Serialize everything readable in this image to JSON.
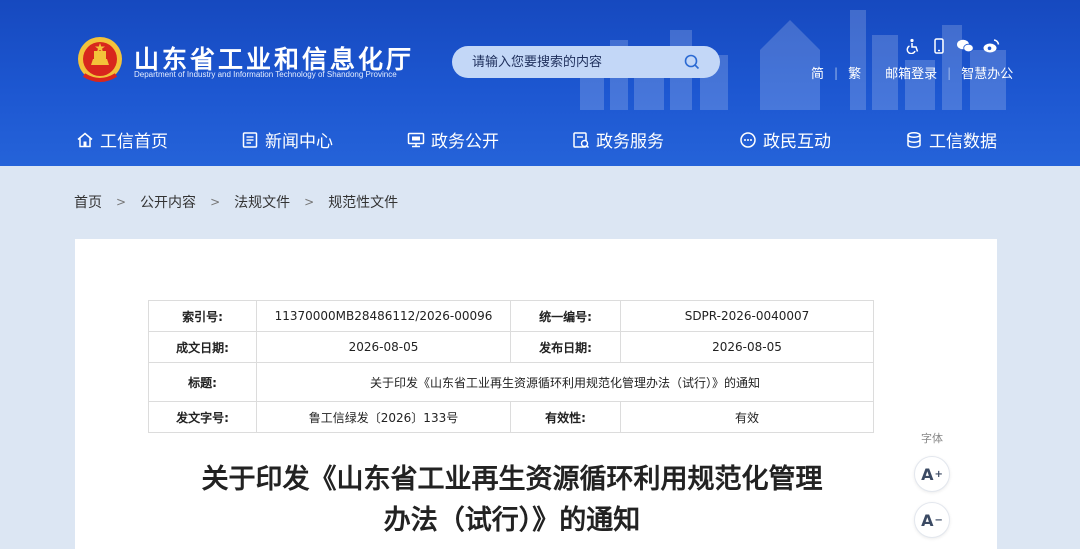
{
  "site": {
    "title": "山东省工业和信息化厅",
    "subtitle": "Department of Industry and Information Technology of Shandong Province"
  },
  "search": {
    "placeholder": "请输入您要搜索的内容"
  },
  "utility": {
    "icons": [
      "accessibility-icon",
      "mobile-icon",
      "wechat-icon",
      "weibo-icon"
    ],
    "links": [
      "简",
      "繁",
      "邮箱登录",
      "智慧办公"
    ]
  },
  "nav": [
    {
      "label": "工信首页",
      "icon": "home-icon"
    },
    {
      "label": "新闻中心",
      "icon": "news-icon"
    },
    {
      "label": "政务公开",
      "icon": "monitor-icon"
    },
    {
      "label": "政务服务",
      "icon": "service-icon"
    },
    {
      "label": "政民互动",
      "icon": "chat-icon"
    },
    {
      "label": "工信数据",
      "icon": "database-icon"
    }
  ],
  "breadcrumb": [
    "首页",
    "公开内容",
    "法规文件",
    "规范性文件"
  ],
  "meta": {
    "index_label": "索引号:",
    "index_value": "11370000MB28486112/2026-00096",
    "code_label": "统一编号:",
    "code_value": "SDPR-2026-0040007",
    "created_label": "成文日期:",
    "created_value": "2026-08-05",
    "published_label": "发布日期:",
    "published_value": "2026-08-05",
    "title_label": "标题:",
    "title_value": "关于印发《山东省工业再生资源循环利用规范化管理办法（试行）》的通知",
    "docno_label": "发文字号:",
    "docno_value": "鲁工信绿发〔2026〕133号",
    "validity_label": "有效性:",
    "validity_value": "有效"
  },
  "article": {
    "title_line1": "关于印发《山东省工业再生资源循环利用规范化管理",
    "title_line2": "办法（试行）》的通知"
  },
  "font_tool": {
    "label": "字体",
    "increase": "A",
    "decrease": "A"
  },
  "colors": {
    "header": "#1d57d1",
    "search_bg": "#c3d7f7",
    "page_bg": "#dce6f3"
  }
}
